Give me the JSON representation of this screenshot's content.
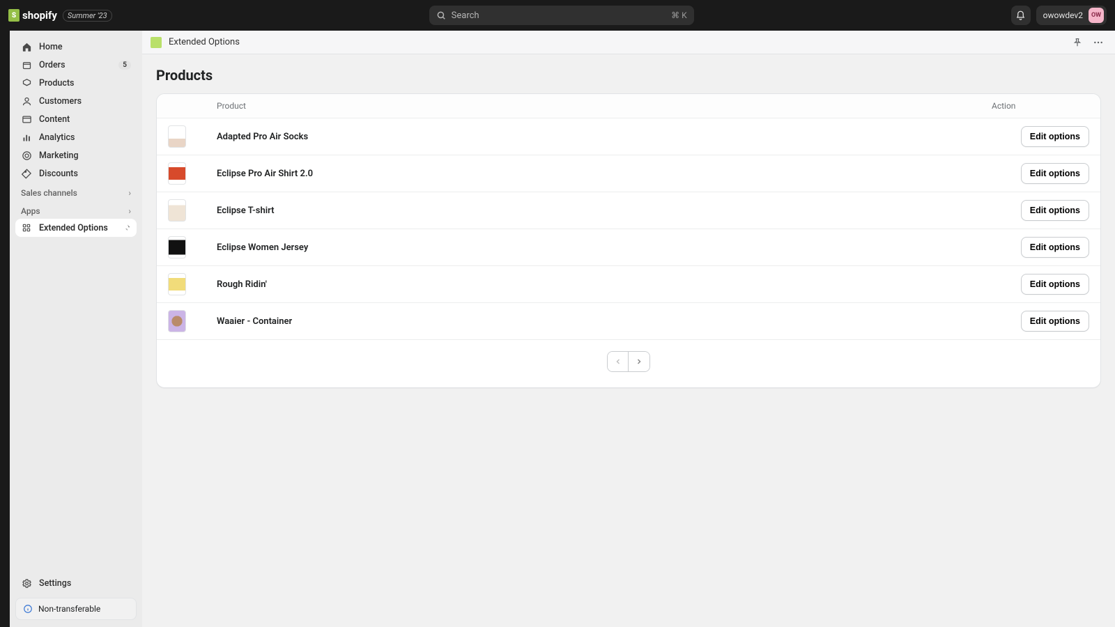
{
  "brand": {
    "name": "shopify",
    "badge": "Summer '23"
  },
  "search": {
    "placeholder": "Search",
    "shortcut": "⌘ K"
  },
  "user": {
    "name": "owowdev2",
    "initials": "OW"
  },
  "sidebar": {
    "items": [
      {
        "label": "Home"
      },
      {
        "label": "Orders",
        "count": "5"
      },
      {
        "label": "Products"
      },
      {
        "label": "Customers"
      },
      {
        "label": "Content"
      },
      {
        "label": "Analytics"
      },
      {
        "label": "Marketing"
      },
      {
        "label": "Discounts"
      }
    ],
    "sales_channels_label": "Sales channels",
    "apps_label": "Apps",
    "app_items": [
      {
        "label": "Extended Options"
      }
    ],
    "settings_label": "Settings",
    "nontransfer_label": "Non-transferable"
  },
  "apphdr": {
    "title": "Extended Options"
  },
  "page": {
    "title": "Products",
    "columns": {
      "product": "Product",
      "action": "Action"
    },
    "action_button": "Edit options",
    "products": [
      {
        "name": "Adapted Pro Air Socks"
      },
      {
        "name": "Eclipse Pro Air Shirt 2.0"
      },
      {
        "name": "Eclipse T-shirt"
      },
      {
        "name": "Eclipse Women Jersey"
      },
      {
        "name": "Rough Ridin'"
      },
      {
        "name": "Waaier - Container"
      }
    ]
  }
}
